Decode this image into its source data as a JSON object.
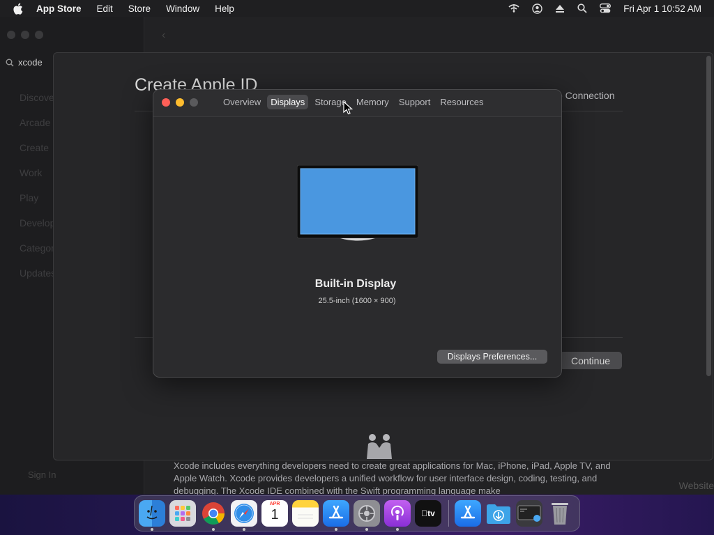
{
  "menubar": {
    "app_name": "App Store",
    "items": [
      "Edit",
      "Store",
      "Window",
      "Help"
    ],
    "clock": "Fri Apr 1  10:52 AM"
  },
  "appstore": {
    "search_value": "xcode",
    "sidebar_items": [
      "Discover",
      "Arcade",
      "Create",
      "Work",
      "Play",
      "Develop",
      "Categories",
      "Updates"
    ],
    "sign_in": "Sign In",
    "description": "Xcode includes everything developers need to create great applications for Mac, iPhone, iPad, Apple TV, and Apple Watch. Xcode provides developers a unified workflow for user interface design, coding, testing, and debugging. The Xcode IDE combined with the Swift programming language make",
    "website_link": "Website"
  },
  "sheet": {
    "title": "Create Apple ID",
    "connection_text": "e Connection",
    "continue_label": "Continue"
  },
  "about": {
    "tabs": [
      "Overview",
      "Displays",
      "Storage",
      "Memory",
      "Support",
      "Resources"
    ],
    "active_tab": "Displays",
    "display_name": "Built-in Display",
    "display_size": "25.5-inch (1600 × 900)",
    "prefs_button": "Displays Preferences..."
  },
  "dock": {
    "calendar_month": "APR",
    "calendar_day": "1",
    "tv_label": "tv",
    "apps": [
      "Finder",
      "Launchpad",
      "Google Chrome",
      "Safari",
      "Calendar",
      "Notes",
      "App Store",
      "System Preferences",
      "Podcasts",
      "Apple TV",
      "App Store Download",
      "Downloads",
      "Screenshot",
      "Trash"
    ]
  },
  "colors": {
    "close": "#fe5f57",
    "minimize": "#febc2e",
    "screen_blue": "#4a97e0",
    "desktop_purple": "#2a1a58"
  }
}
